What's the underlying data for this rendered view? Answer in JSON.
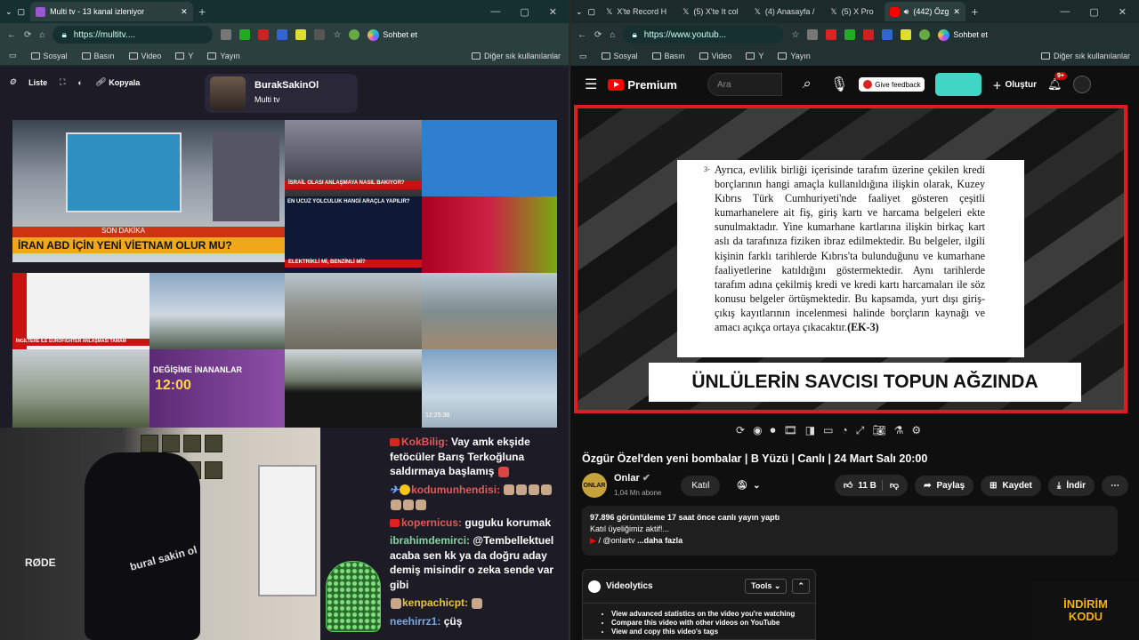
{
  "left": {
    "tabs": [
      {
        "label": "Multi tv - 13 kanal izleniyor"
      }
    ],
    "url": "https://multitv....",
    "copilot_label": "Sohbet et",
    "bookmarks": [
      "Sosyal",
      "Basın",
      "Video",
      "Y",
      "Yayın"
    ],
    "bookmarks_right": "Diğer sık kullanılanlar",
    "toolbar": {
      "list": "Liste",
      "copy": "Kopyala"
    },
    "channel": {
      "name": "BurakSakinOl",
      "site": "Multi tv"
    },
    "tiles": {
      "t1_banner": "İRAN ABD İÇİN YENİ VİETNAM OLUR MU?",
      "t1_tag": "SON DAKİKA",
      "t1_ticker": "İNGİLTERE İLE EUROFIGHTER ANLAŞMASI TAMAM",
      "t2_caption": "İSRAİL OLASI ANLAŞMAYA NASIL BAKIYOR?",
      "t3_caption": "EN UCUZ YOLCULUK HANGİ ARAÇLA YAPILIR?",
      "t3_caption2": "ELEKTRİKLİ Mİ, BENZİNLİ Mİ?",
      "t4_caption": "DEĞİŞİME İNANANLAR",
      "t4_time": "12:00",
      "t5_time": "12:25:38"
    },
    "cam": {
      "brand": "bural sakin ol",
      "mic": "RØDE"
    },
    "chat": [
      {
        "user": "KokBilig:",
        "user_color": "#e05a5a",
        "text": "Vay amk ekşide fetöcüler Barış Terkoğluna saldırmaya başlamış"
      },
      {
        "user": "kodumunhendisi:",
        "user_color": "#e05a5a",
        "text": ""
      },
      {
        "user": "kopernicus:",
        "user_color": "#e05a5a",
        "text": "guguku korumak"
      },
      {
        "user": "ibrahimdemirci:",
        "user_color": "#7fd6a0",
        "text": "@Tembellektuel acaba sen kk ya da doğru aday demiş misindir o zeka sende var gibi"
      },
      {
        "user": "kenpachicpt:",
        "user_color": "#e9c542",
        "text": ""
      },
      {
        "user": "neehirrz1:",
        "user_color": "#7aa9e0",
        "text": "çüş"
      }
    ]
  },
  "right": {
    "tabs": [
      {
        "label": "X'te Record H"
      },
      {
        "label": "(5) X'te It col"
      },
      {
        "label": "(4) Anasayfa /"
      },
      {
        "label": "(5) X Pro"
      },
      {
        "label": "(442) Özg"
      }
    ],
    "url": "https://www.youtub...",
    "copilot_label": "Sohbet et",
    "bookmarks": [
      "Sosyal",
      "Basın",
      "Video",
      "Y",
      "Yayın"
    ],
    "bookmarks_right": "Diğer sık kullanılanlar",
    "yt": {
      "logo": "Premium",
      "search_placeholder": "Ara",
      "feedback": "Give feedback",
      "create": "Oluştur",
      "notif_count": "9+",
      "doc_num": "3-",
      "doc_text": "Ayrıca, evlilik birliği içerisinde tarafım üzerine çekilen kredi borçlarının hangi amaçla kullanıldığına ilişkin olarak, Kuzey Kıbrıs Türk Cumhuriyeti'nde faaliyet gösteren çeşitli kumarhanelere ait fiş, giriş kartı ve harcama belgeleri ekte sunulmaktadır. Yine kumarhane kartlarına ilişkin birkaç kart aslı da tarafınıza fiziken ibraz edilmektedir. Bu belgeler, ilgili kişinin farklı tarihlerde Kıbrıs'ta bulunduğunu ve kumarhane faaliyetlerine katıldığını göstermektedir. Aynı tarihlerde tarafım adına çekilmiş kredi ve kredi kartı harcamaları ile söz konusu belgeler örtüşmektedir. Bu kapsamda, yurt dışı giriş-çıkış kayıtlarının incelenmesi halinde borçların kaynağı ve amacı açıkça ortaya çıkacaktır.",
      "doc_ref": "(EK-3)",
      "caption": "ÜNLÜLERİN SAVCISI TOPUN AĞZINDA",
      "title": "Özgür Özel'den yeni bombalar | B Yüzü | Canlı | 24 Mart Salı 20:00",
      "channel": "Onlar",
      "subs": "1,04 Mn abone",
      "join": "Katıl",
      "likes": "11 B",
      "share": "Paylaş",
      "save": "Kaydet",
      "download": "İndir",
      "desc_stats": "97.896 görüntüleme  17 saat önce canlı yayın yaptı",
      "desc_line2": "Katıl üyeliğimiz aktif!...",
      "desc_handle": "/ @onlartv",
      "desc_more": "...daha fazla",
      "vl_name": "Videolytics",
      "vl_tools": "Tools",
      "vl_items": [
        "View advanced statistics on the video you're watching",
        "Compare this video with other videos on YouTube",
        "View and copy this video's tags"
      ],
      "promo_l1": "İNDİRİM",
      "promo_l2": "KODU"
    }
  }
}
